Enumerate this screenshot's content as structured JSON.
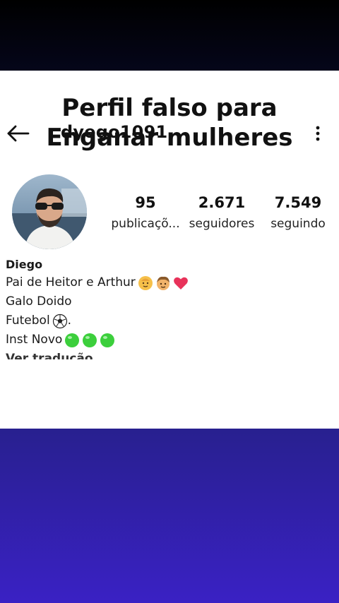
{
  "headline": {
    "line1": "Perfil falso para",
    "line2": "Enganar mulheres"
  },
  "profile": {
    "username": "dyego1091",
    "back_icon": "arrow-left-icon",
    "more_icon": "more-vertical-icon"
  },
  "stats": [
    {
      "value": "95",
      "label": "publicaçõ..."
    },
    {
      "value": "2.671",
      "label": "seguidores"
    },
    {
      "value": "7.549",
      "label": "seguindo"
    }
  ],
  "bio": {
    "name": "Diego",
    "line1": "Pai de Heitor e Arthur",
    "line2": "Galo Doido",
    "line3": "Futebol",
    "line3_suffix": ".",
    "line4": "Inst Novo",
    "translate": "Ver tradução"
  },
  "icons": {
    "line1": [
      "baby-face-icon",
      "boy-face-icon",
      "heart-icon"
    ],
    "line3": [
      "soccer-ball-icon"
    ],
    "line4": [
      "green-circle-icon",
      "green-circle-icon",
      "green-circle-icon"
    ]
  },
  "colors": {
    "top_bar": "#000000",
    "card": "#ffffff",
    "bottom_panel": "#3122b0",
    "text": "#111111",
    "heart": "#e8325a",
    "green_circle": "#3ccf3c"
  }
}
